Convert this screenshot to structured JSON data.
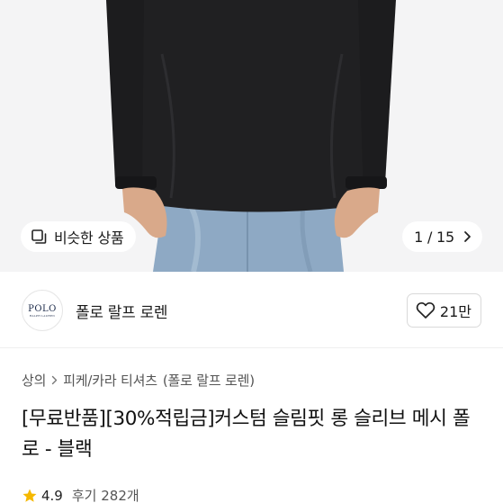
{
  "gallery": {
    "similar_label": "비슷한 상품",
    "similar_icon": "similar-items-icon",
    "page_indicator": "1 / 15",
    "next_icon": "chevron-right-icon"
  },
  "seller": {
    "logo_text": "POLO",
    "logo_subtext": "RALPH LAUREN",
    "name": "폴로 랄프 로렌",
    "likes": "21만",
    "like_icon": "heart-outline-icon"
  },
  "breadcrumb": {
    "items": [
      "상의",
      "피케/카라 티셔츠",
      "(폴로 랄프 로렌)"
    ]
  },
  "product": {
    "title": "[무료반품][30%적립금]커스텀 슬림핏 롱 슬리브 메시 폴로 - 블랙",
    "rating": "4.9",
    "reviews": "후기 282개"
  },
  "colors": {
    "star": "#f5b800",
    "shirt": "#1c1c1e",
    "denim": "#8ea9c4"
  }
}
